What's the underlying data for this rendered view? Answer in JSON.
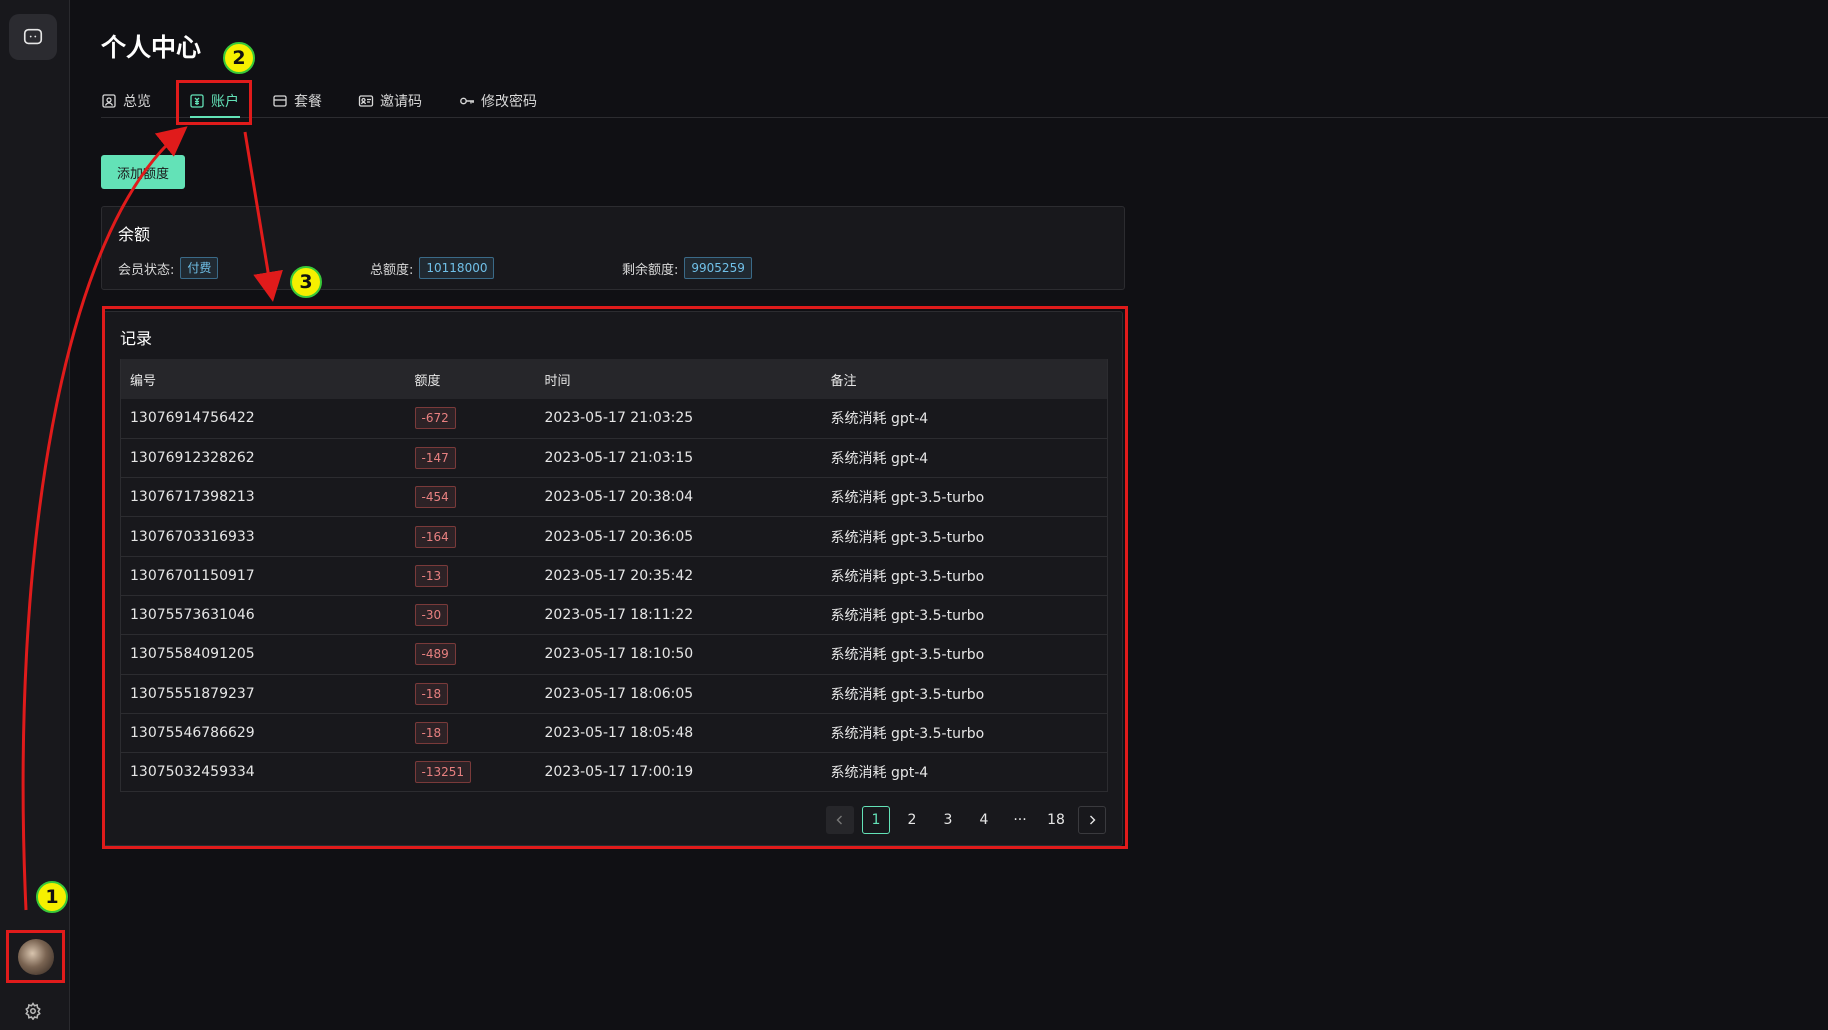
{
  "sidebar": {
    "top_icon": "chat-bubble-icon",
    "avatar": "user-avatar",
    "bottom_icon": "gear-icon"
  },
  "page_title": "个人中心",
  "tabs": [
    {
      "label": "总览",
      "icon": "user-card-icon",
      "active": false
    },
    {
      "label": "账户",
      "icon": "account-icon",
      "active": true
    },
    {
      "label": "套餐",
      "icon": "card-icon",
      "active": false
    },
    {
      "label": "邀请码",
      "icon": "id-card-icon",
      "active": false
    },
    {
      "label": "修改密码",
      "icon": "key-icon",
      "active": false
    }
  ],
  "add_button_label": "添加额度",
  "balance": {
    "title": "余额",
    "status_label": "会员状态:",
    "status_value": "付费",
    "total_label": "总额度:",
    "total_value": "10118000",
    "remaining_label": "剩余额度:",
    "remaining_value": "9905259"
  },
  "records": {
    "title": "记录",
    "columns": [
      "编号",
      "额度",
      "时间",
      "备注"
    ],
    "rows": [
      [
        "13076914756422",
        "-672",
        "2023-05-17 21:03:25",
        "系统消耗 gpt-4"
      ],
      [
        "13076912328262",
        "-147",
        "2023-05-17 21:03:15",
        "系统消耗 gpt-4"
      ],
      [
        "13076717398213",
        "-454",
        "2023-05-17 20:38:04",
        "系统消耗 gpt-3.5-turbo"
      ],
      [
        "13076703316933",
        "-164",
        "2023-05-17 20:36:05",
        "系统消耗 gpt-3.5-turbo"
      ],
      [
        "13076701150917",
        "-13",
        "2023-05-17 20:35:42",
        "系统消耗 gpt-3.5-turbo"
      ],
      [
        "13075573631046",
        "-30",
        "2023-05-17 18:11:22",
        "系统消耗 gpt-3.5-turbo"
      ],
      [
        "13075584091205",
        "-489",
        "2023-05-17 18:10:50",
        "系统消耗 gpt-3.5-turbo"
      ],
      [
        "13075551879237",
        "-18",
        "2023-05-17 18:06:05",
        "系统消耗 gpt-3.5-turbo"
      ],
      [
        "13075546786629",
        "-18",
        "2023-05-17 18:05:48",
        "系统消耗 gpt-3.5-turbo"
      ],
      [
        "13075032459334",
        "-13251",
        "2023-05-17 17:00:19",
        "系统消耗 gpt-4"
      ]
    ]
  },
  "pagination": {
    "pages": [
      "1",
      "2",
      "3",
      "4",
      "···",
      "18"
    ],
    "current": "1"
  },
  "annotations": {
    "badge_1": "1",
    "badge_2": "2",
    "badge_3": "3",
    "highlight_color": "#e01b1b",
    "badge_color": "#f6f000"
  },
  "colors": {
    "accent": "#63e2b7",
    "background": "#101014",
    "card": "#18181c"
  }
}
